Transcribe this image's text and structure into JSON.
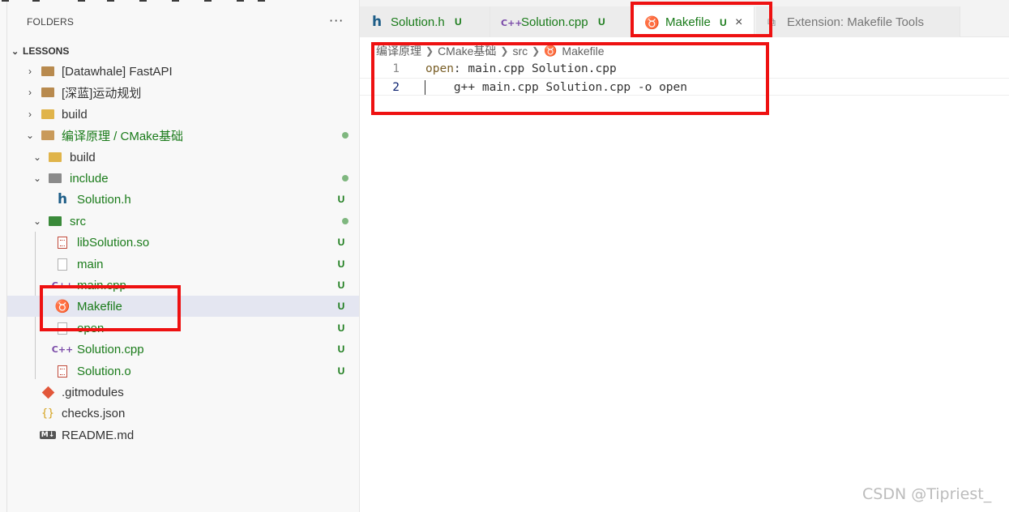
{
  "explorer": {
    "header": "FOLDERS",
    "more_label": "···",
    "section": "LESSONS",
    "rows": [
      {
        "name": "[Datawhale] FastAPI",
        "icon": "folder-icon",
        "git": false,
        "badge": "",
        "dot": false
      },
      {
        "name": "[深蓝]运动规划",
        "icon": "folder-icon",
        "git": false,
        "badge": "",
        "dot": false
      },
      {
        "name": "build",
        "icon": "build-folder-icon",
        "git": false,
        "badge": "",
        "dot": false
      },
      {
        "name": "编译原理 / CMake基础",
        "icon": "folder-open-icon",
        "git": true,
        "badge": "",
        "dot": true
      },
      {
        "name": "build",
        "icon": "build-folder-icon",
        "git": false,
        "badge": "",
        "dot": false
      },
      {
        "name": "include",
        "icon": "include-folder-icon",
        "git": true,
        "badge": "",
        "dot": true
      },
      {
        "name": "Solution.h",
        "icon": "h-file-icon",
        "git": true,
        "badge": "U",
        "dot": false
      },
      {
        "name": "src",
        "icon": "src-folder-icon",
        "git": true,
        "badge": "",
        "dot": true
      },
      {
        "name": "libSolution.so",
        "icon": "binary-file-icon",
        "git": true,
        "badge": "U",
        "dot": false
      },
      {
        "name": "main",
        "icon": "file-icon",
        "git": true,
        "badge": "U",
        "dot": false
      },
      {
        "name": "main.cpp",
        "icon": "cpp-file-icon",
        "git": true,
        "badge": "U",
        "dot": false
      },
      {
        "name": "Makefile",
        "icon": "makefile-icon",
        "git": true,
        "badge": "U",
        "dot": false
      },
      {
        "name": "open",
        "icon": "file-icon",
        "git": true,
        "badge": "U",
        "dot": false
      },
      {
        "name": "Solution.cpp",
        "icon": "cpp-file-icon",
        "git": true,
        "badge": "U",
        "dot": false
      },
      {
        "name": "Solution.o",
        "icon": "binary-file-icon",
        "git": true,
        "badge": "U",
        "dot": false
      },
      {
        "name": ".gitmodules",
        "icon": "git-icon",
        "git": false,
        "badge": "",
        "dot": false
      },
      {
        "name": "checks.json",
        "icon": "json-file-icon",
        "git": false,
        "badge": "",
        "dot": false
      },
      {
        "name": "README.md",
        "icon": "markdown-file-icon",
        "git": false,
        "badge": "",
        "dot": false
      }
    ]
  },
  "tabs": [
    {
      "label": "Solution.h",
      "icon": "h-file-icon",
      "badge": "U",
      "active": false
    },
    {
      "label": "Solution.cpp",
      "icon": "cpp-file-icon",
      "badge": "U",
      "active": false
    },
    {
      "label": "Makefile",
      "icon": "makefile-icon",
      "badge": "U",
      "active": true,
      "close": "×"
    },
    {
      "label": "Extension: Makefile Tools",
      "icon": "extension-icon",
      "badge": "",
      "active": false
    }
  ],
  "breadcrumb": [
    "编译原理",
    "CMake基础",
    "src",
    "Makefile"
  ],
  "editor": {
    "lines": [
      {
        "number": "1",
        "target": "open",
        "rest": ": main.cpp Solution.cpp"
      },
      {
        "number": "2",
        "target": "",
        "rest": "    g++ main.cpp Solution.cpp -o open"
      }
    ]
  },
  "watermark": "CSDN @Tipriest_",
  "colors": {
    "git_untracked": "#1a7b1a",
    "annotation_red": "#ee1111",
    "selection": "#e4e6f1"
  }
}
